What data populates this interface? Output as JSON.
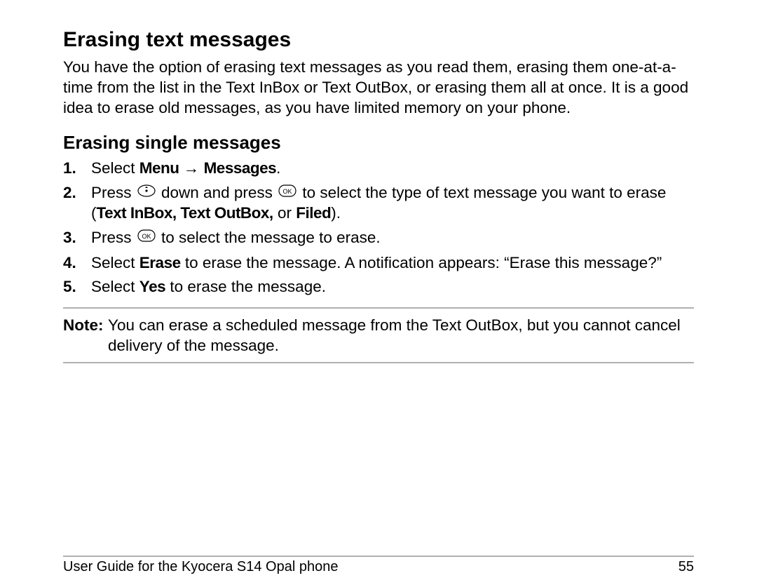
{
  "heading1": "Erasing text messages",
  "intro": "You have the option of erasing text messages as you read them, erasing them one-at-a-time from the list in the Text InBox or Text OutBox, or erasing them all at once. It is a good idea to erase old messages, as you have limited memory on your phone.",
  "heading2": "Erasing single messages",
  "steps": {
    "s1a": "Select ",
    "s1b": "Menu",
    "s1c": " → ",
    "s1d": "Messages",
    "s1e": ".",
    "s2a": "Press ",
    "s2b": " down and press ",
    "s2c": " to select the type of text message you want to erase (",
    "s2d": "Text InBox, Text OutBox,",
    "s2e": " or ",
    "s2f": "Filed",
    "s2g": ").",
    "s3a": "Press ",
    "s3b": " to select the message to erase.",
    "s4a": "Select ",
    "s4b": "Erase",
    "s4c": " to erase the message. A notification appears: “Erase this message?”",
    "s5a": "Select ",
    "s5b": "Yes",
    "s5c": " to erase the message."
  },
  "noteLabel": "Note:",
  "noteBody": "You can erase a scheduled message from the Text OutBox, but you cannot cancel delivery of the message.",
  "footerLeft": "User Guide for the Kyocera S14 Opal phone",
  "footerRight": "55"
}
